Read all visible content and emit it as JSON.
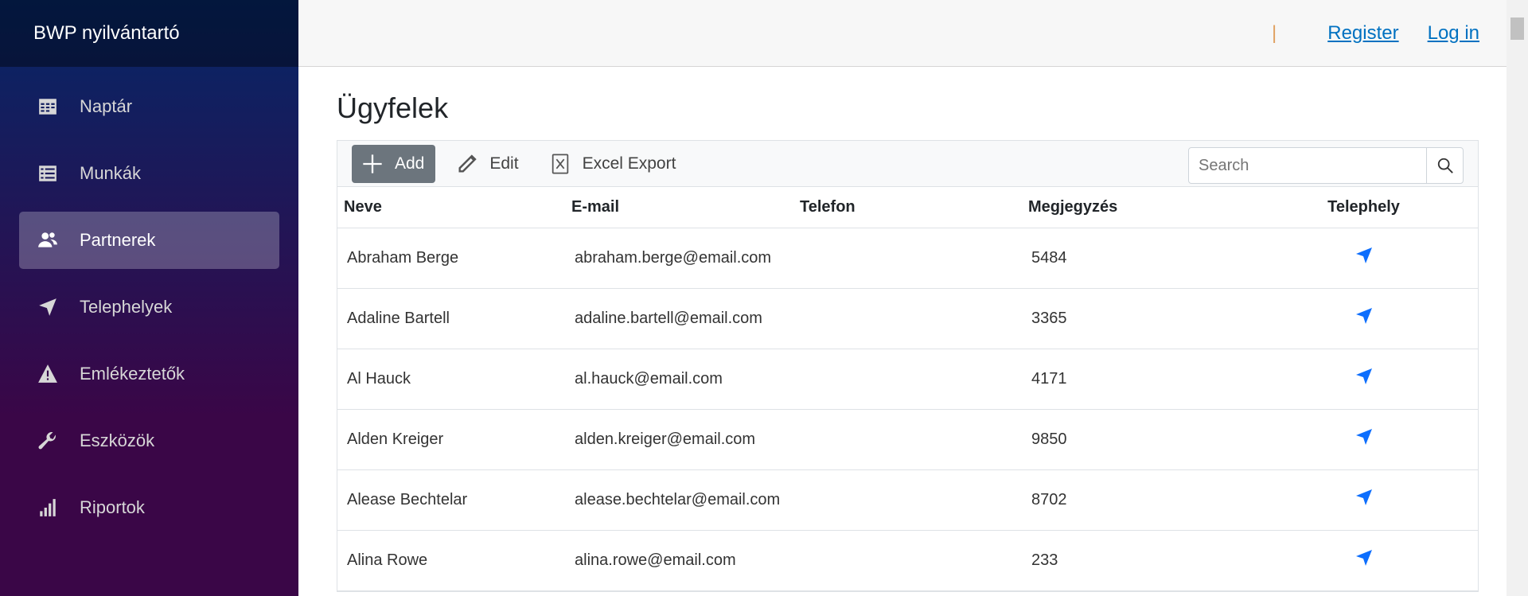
{
  "app": {
    "title": "BWP nyilvántartó"
  },
  "sidebar": {
    "items": [
      {
        "label": "Naptár",
        "icon": "calendar-icon"
      },
      {
        "label": "Munkák",
        "icon": "list-icon"
      },
      {
        "label": "Partnerek",
        "icon": "people-icon",
        "active": true
      },
      {
        "label": "Telephelyek",
        "icon": "location-arrow-icon"
      },
      {
        "label": "Emlékeztetők",
        "icon": "warning-icon"
      },
      {
        "label": "Eszközök",
        "icon": "wrench-icon"
      },
      {
        "label": "Riportok",
        "icon": "bar-chart-icon"
      }
    ]
  },
  "topbar": {
    "separator": "|",
    "register": "Register",
    "login": "Log in"
  },
  "page": {
    "title": "Ügyfelek"
  },
  "toolbar": {
    "add": "Add",
    "edit": "Edit",
    "export": "Excel Export",
    "search_placeholder": "Search"
  },
  "table": {
    "columns": [
      "Neve",
      "E-mail",
      "Telefon",
      "Megjegyzés",
      "Telephely"
    ],
    "rows": [
      {
        "name": "Abraham Berge",
        "email": "abraham.berge@email.com",
        "phone": "",
        "note": "5484"
      },
      {
        "name": "Adaline Bartell",
        "email": "adaline.bartell@email.com",
        "phone": "",
        "note": "3365"
      },
      {
        "name": "Al Hauck",
        "email": "al.hauck@email.com",
        "phone": "",
        "note": "4171"
      },
      {
        "name": "Alden Kreiger",
        "email": "alden.kreiger@email.com",
        "phone": "",
        "note": "9850"
      },
      {
        "name": "Alease Bechtelar",
        "email": "alease.bechtelar@email.com",
        "phone": "",
        "note": "8702"
      },
      {
        "name": "Alina Rowe",
        "email": "alina.rowe@email.com",
        "phone": "",
        "note": "233"
      }
    ]
  },
  "colors": {
    "accent": "#0d6efd",
    "link": "#0071c1",
    "sidebar_top": "#052767",
    "sidebar_bottom": "#3a0647"
  }
}
